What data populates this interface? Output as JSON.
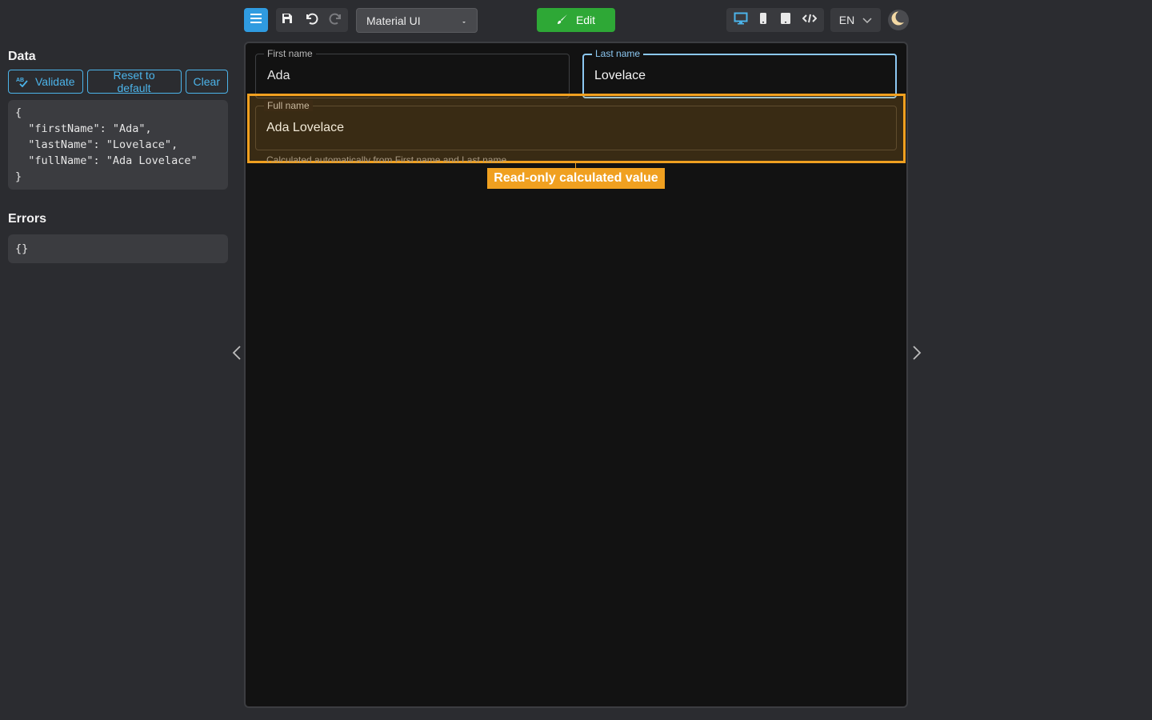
{
  "data_panel": {
    "title": "Data",
    "validate_label": "Validate",
    "reset_label": "Reset to default",
    "clear_label": "Clear",
    "json_text": "{\n  \"firstName\": \"Ada\",\n  \"lastName\": \"Lovelace\",\n  \"fullName\": \"Ada Lovelace\"\n}"
  },
  "errors_panel": {
    "title": "Errors",
    "json_text": "{}"
  },
  "toolbar": {
    "theme_select": "Material UI",
    "edit_label": "Edit",
    "language": "EN",
    "icons": [
      "menu-icon",
      "save-icon",
      "undo-icon",
      "redo-icon",
      "desktop-icon",
      "phone-icon",
      "tablet-icon",
      "code-icon",
      "chevron-down-icon",
      "moon-icon"
    ]
  },
  "form": {
    "first_name": {
      "label": "First name",
      "value": "Ada"
    },
    "last_name": {
      "label": "Last name",
      "value": "Lovelace"
    },
    "full_name": {
      "label": "Full name",
      "value": "Ada Lovelace",
      "helper": "Calculated automatically from First name and Last name"
    },
    "highlight_tag": "Read-only calculated value"
  },
  "colors": {
    "accent": "#2f9be0",
    "edit_green": "#2ea836",
    "highlight_orange": "#f0a020",
    "focus_blue": "#8cc8f2"
  }
}
